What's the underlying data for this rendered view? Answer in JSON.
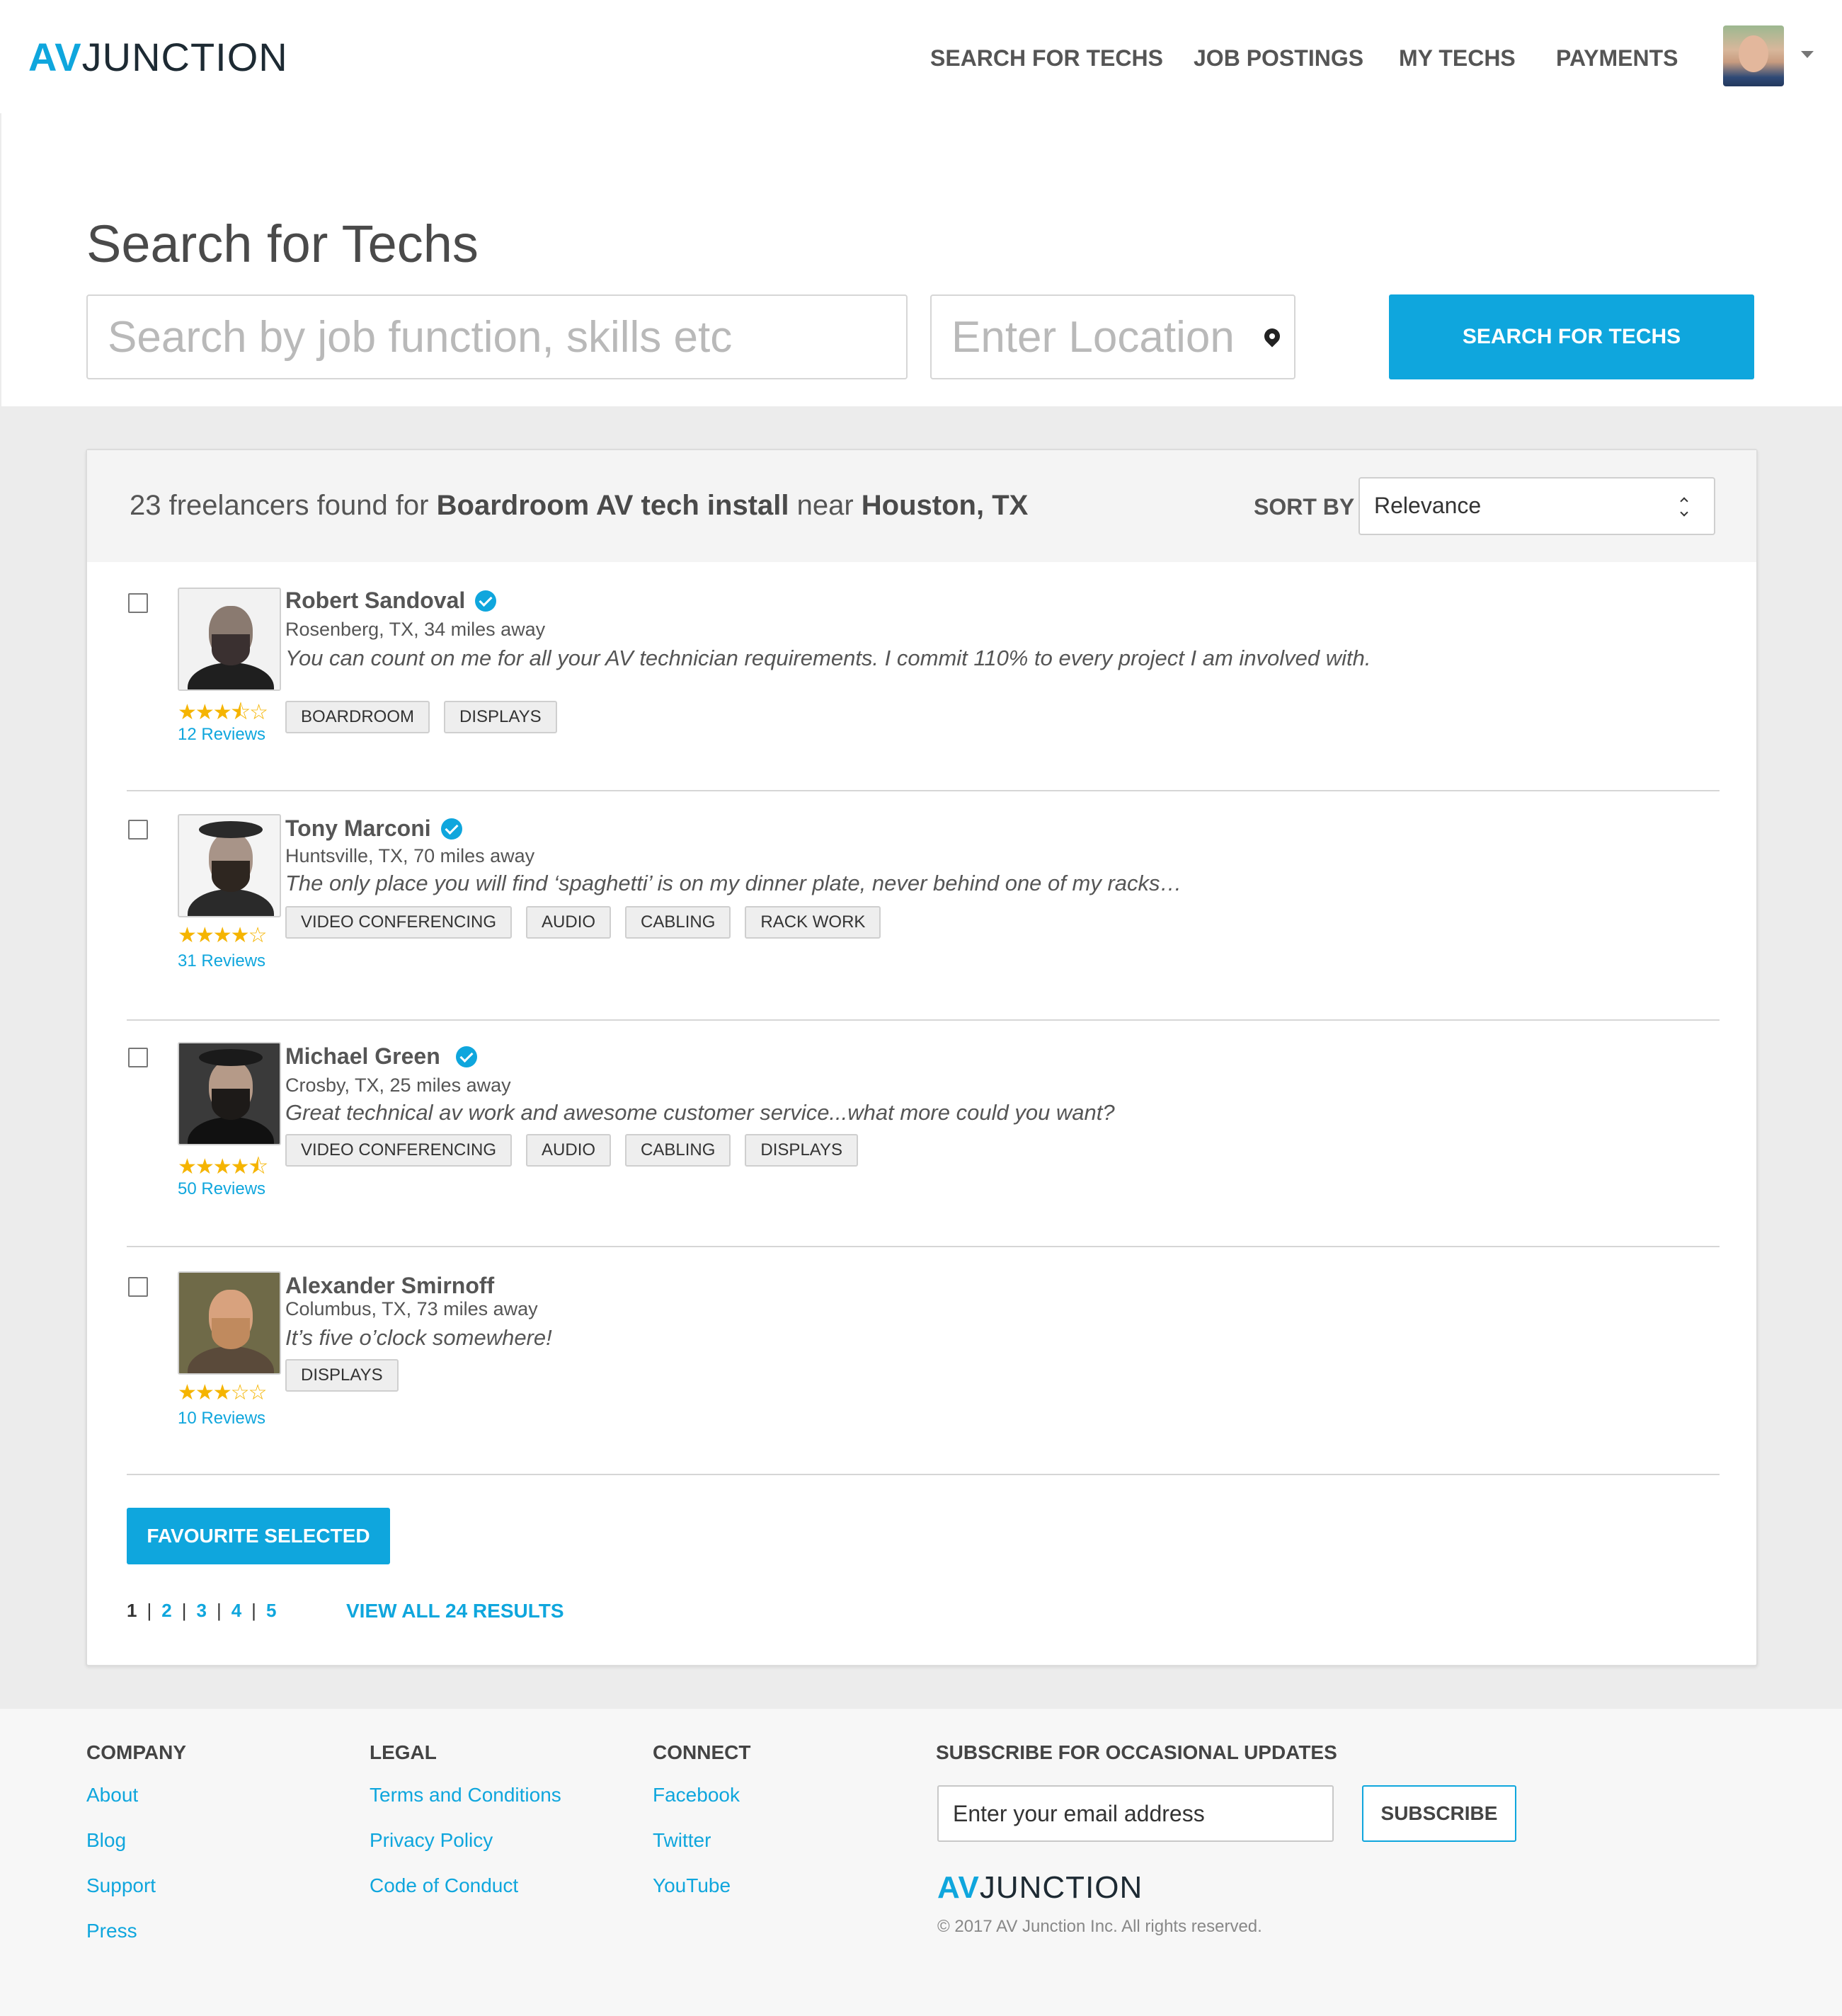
{
  "brand": {
    "logo_accent": "AV",
    "logo_rest": "JUNCTION",
    "accent_color": "#0fa6dd"
  },
  "nav": {
    "items": [
      "SEARCH FOR TECHS",
      "JOB POSTINGS",
      "MY TECHS",
      "PAYMENTS"
    ]
  },
  "hero": {
    "title": "Search for Techs",
    "search_placeholder": "Search by job function, skills etc",
    "location_placeholder": "Enter Location",
    "search_button": "SEARCH FOR TECHS"
  },
  "results": {
    "count": "23",
    "text_found": "freelancers found for",
    "query": "Boardroom AV tech install",
    "text_near": "near",
    "location": "Houston, TX",
    "sort_label": "SORT BY",
    "sort_value": "Relevance",
    "techs": [
      {
        "name": "Robert Sandoval",
        "verified": true,
        "location": "Rosenberg, TX, 34 miles away",
        "quote": "You can count on me for all your AV technician requirements.  I commit 110% to every project I am involved with.",
        "rating": 3.5,
        "stars": "★★★⯪☆",
        "reviews": "12 Reviews",
        "tags": [
          "BOARDROOM",
          "DISPLAYS"
        ]
      },
      {
        "name": "Tony Marconi",
        "verified": true,
        "location": "Huntsville, TX, 70 miles away",
        "quote": "The only place you will find ‘spaghetti’ is on my dinner plate, never behind one of my racks…",
        "rating": 4,
        "stars": "★★★★☆",
        "reviews": "31 Reviews",
        "tags": [
          "VIDEO CONFERENCING",
          "AUDIO",
          "CABLING",
          "RACK WORK"
        ]
      },
      {
        "name": "Michael Green",
        "verified": true,
        "location": "Crosby, TX, 25 miles away",
        "quote": "Great technical av work and awesome customer service...what more could you want?",
        "rating": 4.5,
        "stars": "★★★★⯪",
        "reviews": "50 Reviews",
        "tags": [
          "VIDEO CONFERENCING",
          "AUDIO",
          "CABLING",
          "DISPLAYS"
        ]
      },
      {
        "name": "Alexander Smirnoff",
        "verified": false,
        "location": "Columbus, TX, 73 miles away",
        "quote": "It’s five o’clock somewhere!",
        "rating": 3,
        "stars": "★★★☆☆",
        "reviews": "10 Reviews",
        "tags": [
          "DISPLAYS"
        ]
      }
    ],
    "favourite_button": "FAVOURITE SELECTED",
    "pages": [
      "1",
      "2",
      "3",
      "4",
      "5"
    ],
    "current_page": "1",
    "view_all": "VIEW ALL 24 RESULTS"
  },
  "footer": {
    "company": {
      "heading": "COMPANY",
      "links": [
        "About",
        "Blog",
        "Support",
        "Press"
      ]
    },
    "legal": {
      "heading": "LEGAL",
      "links": [
        "Terms and Conditions",
        "Privacy Policy",
        "Code of Conduct"
      ]
    },
    "connect": {
      "heading": "CONNECT",
      "links": [
        "Facebook",
        "Twitter",
        "YouTube"
      ]
    },
    "subscribe": {
      "heading": "SUBSCRIBE FOR OCCASIONAL UPDATES",
      "email_placeholder": "Enter your email address",
      "button": "SUBSCRIBE"
    },
    "copyright": "© 2017 AV Junction Inc. All rights reserved."
  }
}
